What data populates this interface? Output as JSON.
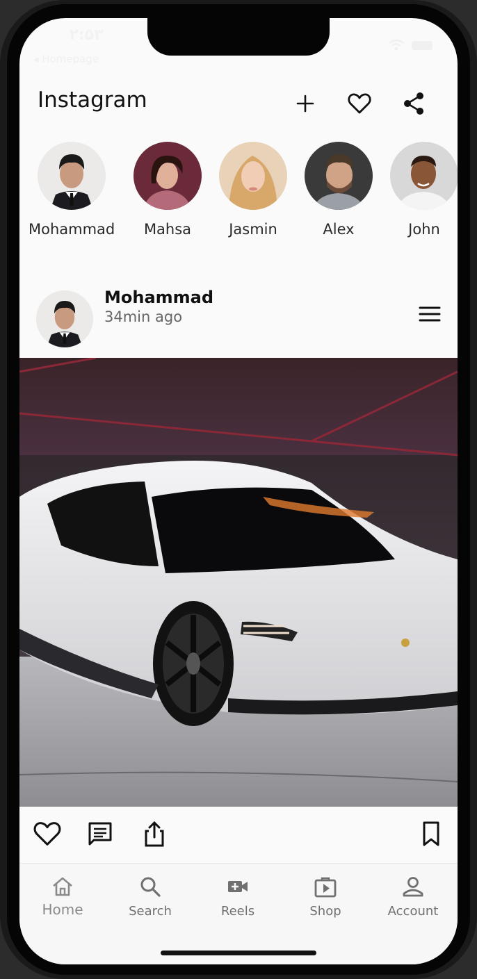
{
  "status_bar": {
    "time": "۲:۵۳",
    "back_label": "◂ Homepage"
  },
  "header": {
    "title": "Instagram",
    "actions": [
      {
        "icon": "plus-icon"
      },
      {
        "icon": "heart-icon"
      },
      {
        "icon": "share-icon"
      }
    ]
  },
  "stories": [
    {
      "name": "Mohammad"
    },
    {
      "name": "Mahsa"
    },
    {
      "name": "Jasmin"
    },
    {
      "name": "Alex"
    },
    {
      "name": "John"
    }
  ],
  "post": {
    "username": "Mohammad",
    "time_ago": "34min ago",
    "image": "white-sports-car-photo",
    "actions": [
      "heart-icon",
      "comment-icon",
      "share-upload-icon",
      "bookmark-icon"
    ]
  },
  "bottom_nav": {
    "items": [
      {
        "label": "Home",
        "icon": "home-icon",
        "active": true
      },
      {
        "label": "Search",
        "icon": "search-icon"
      },
      {
        "label": "Reels",
        "icon": "video-icon"
      },
      {
        "label": "Shop",
        "icon": "shop-icon"
      },
      {
        "label": "Account",
        "icon": "person-icon"
      }
    ]
  },
  "colors": {
    "background": "#fafafa",
    "text": "#111111",
    "muted": "#707070"
  }
}
